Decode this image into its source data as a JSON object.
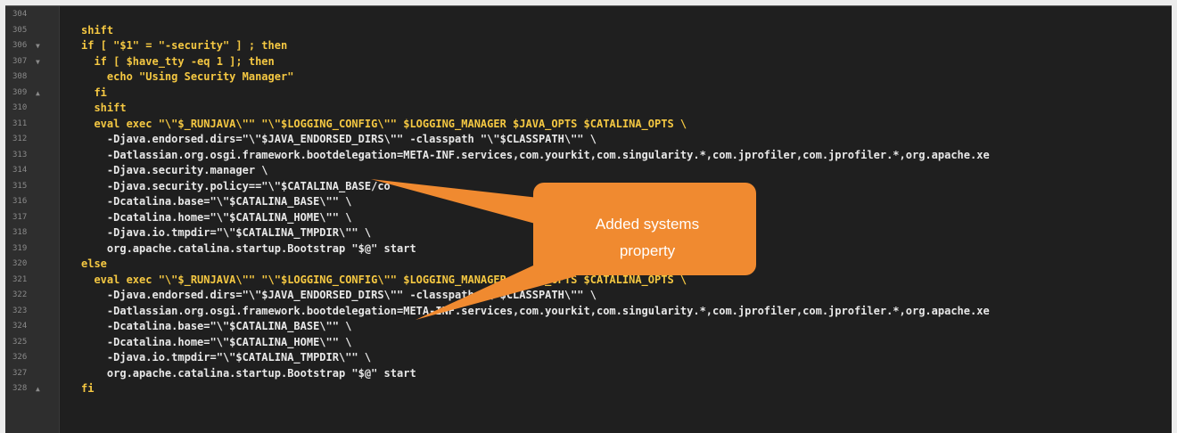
{
  "editor": {
    "gutter_lines": [
      {
        "num": "304",
        "fold": ""
      },
      {
        "num": "305",
        "fold": ""
      },
      {
        "num": "306",
        "fold": "▼"
      },
      {
        "num": "307",
        "fold": "▼"
      },
      {
        "num": "308",
        "fold": ""
      },
      {
        "num": "309",
        "fold": "▲"
      },
      {
        "num": "310",
        "fold": ""
      },
      {
        "num": "311",
        "fold": ""
      },
      {
        "num": "312",
        "fold": ""
      },
      {
        "num": "313",
        "fold": ""
      },
      {
        "num": "314",
        "fold": ""
      },
      {
        "num": "315",
        "fold": ""
      },
      {
        "num": "316",
        "fold": ""
      },
      {
        "num": "317",
        "fold": ""
      },
      {
        "num": "318",
        "fold": ""
      },
      {
        "num": "319",
        "fold": ""
      },
      {
        "num": "320",
        "fold": ""
      },
      {
        "num": "321",
        "fold": ""
      },
      {
        "num": "322",
        "fold": ""
      },
      {
        "num": "323",
        "fold": ""
      },
      {
        "num": "324",
        "fold": ""
      },
      {
        "num": "325",
        "fold": ""
      },
      {
        "num": "326",
        "fold": ""
      },
      {
        "num": "327",
        "fold": ""
      },
      {
        "num": "328",
        "fold": "▲"
      }
    ],
    "code_lines": [
      "",
      "shift",
      "if [ \"$1\" = \"-security\" ] ; then",
      "  if [ $have_tty -eq 1 ]; then",
      "    echo \"Using Security Manager\"",
      "  fi",
      "  shift",
      "  eval exec \"\\\"$_RUNJAVA\\\"\" \"\\\"$LOGGING_CONFIG\\\"\" $LOGGING_MANAGER $JAVA_OPTS $CATALINA_OPTS \\",
      "    -Djava.endorsed.dirs=\"\\\"$JAVA_ENDORSED_DIRS\\\"\" -classpath \"\\\"$CLASSPATH\\\"\" \\",
      "    -Datlassian.org.osgi.framework.bootdelegation=META-INF.services,com.yourkit,com.singularity.*,com.jprofiler,com.jprofiler.*,org.apache.xe",
      "    -Djava.security.manager \\",
      "    -Djava.security.policy==\"\\\"$CATALINA_BASE/co",
      "    -Dcatalina.base=\"\\\"$CATALINA_BASE\\\"\" \\",
      "    -Dcatalina.home=\"\\\"$CATALINA_HOME\\\"\" \\",
      "    -Djava.io.tmpdir=\"\\\"$CATALINA_TMPDIR\\\"\" \\",
      "    org.apache.catalina.startup.Bootstrap \"$@\" start",
      "else",
      "  eval exec \"\\\"$_RUNJAVA\\\"\" \"\\\"$LOGGING_CONFIG\\\"\" $LOGGING_MANAGER $JAVA_OPTS $CATALINA_OPTS \\",
      "    -Djava.endorsed.dirs=\"\\\"$JAVA_ENDORSED_DIRS\\\"\" -classpath \"\\\"$CLASSPATH\\\"\" \\",
      "    -Datlassian.org.osgi.framework.bootdelegation=META-INF.services,com.yourkit,com.singularity.*,com.jprofiler,com.jprofiler.*,org.apache.xe",
      "    -Dcatalina.base=\"\\\"$CATALINA_BASE\\\"\" \\",
      "    -Dcatalina.home=\"\\\"$CATALINA_HOME\\\"\" \\",
      "    -Djava.io.tmpdir=\"\\\"$CATALINA_TMPDIR\\\"\" \\",
      "    org.apache.catalina.startup.Bootstrap \"$@\" start",
      "fi"
    ]
  },
  "callout": {
    "line1": "Added systems",
    "line2": "property",
    "color": "#f08a30"
  },
  "colors": {
    "background": "#1f1f1f",
    "gutter": "#2e2e2e",
    "keyword": "#f5c842",
    "variable": "#8ab4f8",
    "text": "#e8e8e8"
  }
}
